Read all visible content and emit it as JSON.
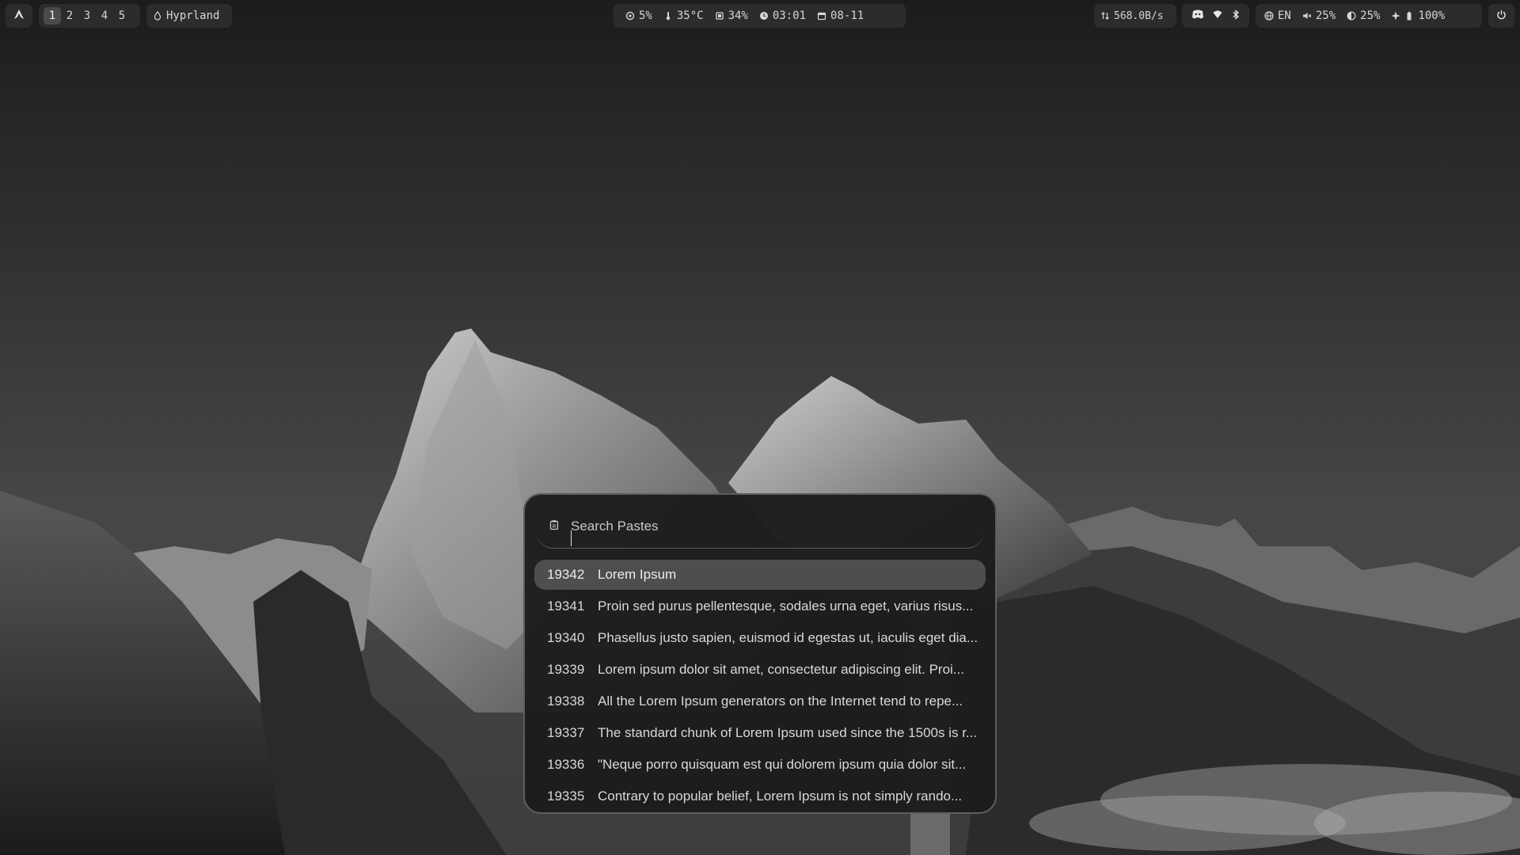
{
  "bar": {
    "workspaces": [
      "1",
      "2",
      "3",
      "4",
      "5"
    ],
    "active_workspace": "1",
    "window_title": "Hyprland",
    "status": {
      "cpu": "5%",
      "temperature": "35°C",
      "memory": "34%",
      "time": "03:01",
      "date": "08-11"
    },
    "network_speed": "568.0B/s",
    "language": "EN",
    "volume": "25%",
    "brightness": "25%",
    "battery": "100%",
    "icons": [
      "arch-logo-icon",
      "drop-icon",
      "cpu-icon",
      "thermometer-icon",
      "memory-icon",
      "clock-icon",
      "calendar-icon",
      "network-arrows-icon",
      "discord-icon",
      "wifi-icon",
      "bluetooth-icon",
      "globe-icon",
      "mute-icon",
      "brightness-icon",
      "power-saver-icon",
      "battery-icon",
      "power-icon"
    ]
  },
  "clipboard": {
    "search_placeholder": "Search Pastes",
    "search_value": "",
    "items": [
      {
        "id": "19342",
        "text": "Lorem Ipsum"
      },
      {
        "id": "19341",
        "text": "Proin sed purus pellentesque, sodales urna eget, varius risus..."
      },
      {
        "id": "19340",
        "text": "Phasellus justo sapien, euismod id egestas ut, iaculis eget dia..."
      },
      {
        "id": "19339",
        "text": "Lorem ipsum dolor sit amet, consectetur adipiscing elit. Proi..."
      },
      {
        "id": "19338",
        "text": "All the Lorem Ipsum generators on the Internet tend to repe..."
      },
      {
        "id": "19337",
        "text": "The standard chunk of Lorem Ipsum used since the 1500s is r..."
      },
      {
        "id": "19336",
        "text": "\"Neque porro quisquam est qui dolorem ipsum quia dolor sit..."
      },
      {
        "id": "19335",
        "text": "Contrary to popular belief, Lorem Ipsum is not simply rando..."
      }
    ],
    "selected_index": 0
  },
  "colors": {
    "bar_module": "#2c2c2c",
    "popup_bg": "#1c1c1c",
    "popup_border": "#5e5e5e",
    "selected_row": "#4e4e4e"
  }
}
